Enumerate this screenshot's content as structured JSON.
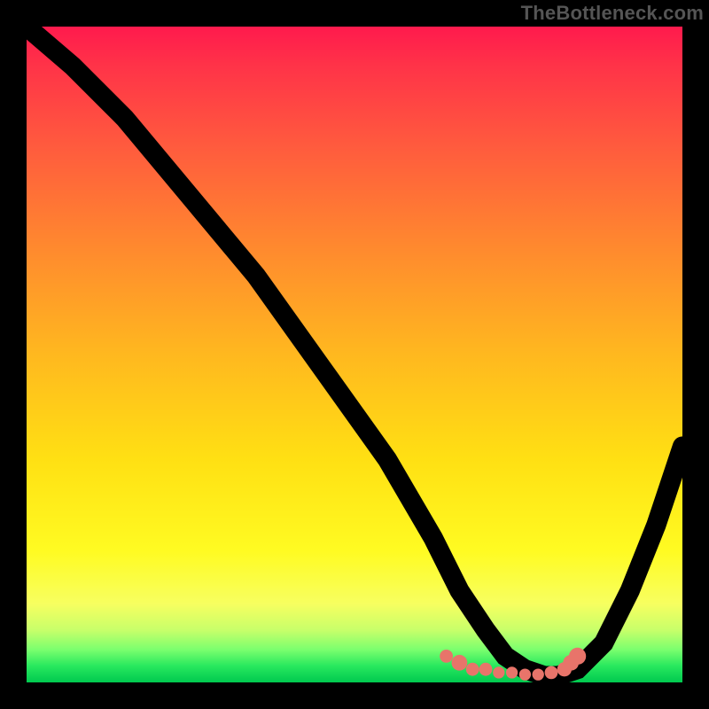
{
  "attribution": "TheBottleneck.com",
  "chart_data": {
    "type": "line",
    "title": "",
    "xlabel": "",
    "ylabel": "",
    "xlim": [
      0,
      100
    ],
    "ylim": [
      0,
      100
    ],
    "background": "red-yellow-green vertical gradient (red=top=high bottleneck, green=bottom=low bottleneck)",
    "series": [
      {
        "name": "bottleneck-curve",
        "x": [
          0,
          7,
          15,
          25,
          35,
          45,
          55,
          62,
          66,
          70,
          73,
          76,
          79,
          81,
          84,
          88,
          92,
          96,
          100
        ],
        "values": [
          100,
          94,
          86,
          74,
          62,
          48,
          34,
          22,
          14,
          8,
          4,
          2,
          1,
          1,
          2,
          6,
          14,
          24,
          36
        ]
      }
    ],
    "markers": {
      "name": "bottom-cluster-dots",
      "approx_region": "valley near x≈66–84, y≈1–4",
      "points": [
        {
          "x": 64,
          "y": 4,
          "r": 1.0
        },
        {
          "x": 66,
          "y": 3,
          "r": 1.2
        },
        {
          "x": 68,
          "y": 2,
          "r": 1.0
        },
        {
          "x": 70,
          "y": 2,
          "r": 1.0
        },
        {
          "x": 72,
          "y": 1.5,
          "r": 0.9
        },
        {
          "x": 74,
          "y": 1.5,
          "r": 0.9
        },
        {
          "x": 76,
          "y": 1.2,
          "r": 0.9
        },
        {
          "x": 78,
          "y": 1.2,
          "r": 0.9
        },
        {
          "x": 80,
          "y": 1.5,
          "r": 1.0
        },
        {
          "x": 82,
          "y": 2,
          "r": 1.1
        },
        {
          "x": 83,
          "y": 3,
          "r": 1.2
        },
        {
          "x": 84,
          "y": 4,
          "r": 1.3
        }
      ]
    }
  }
}
